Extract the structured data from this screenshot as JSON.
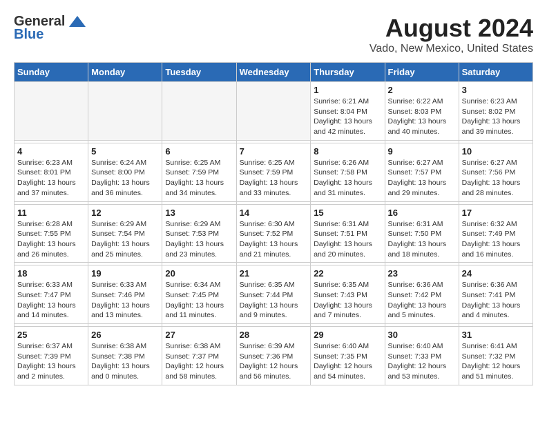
{
  "header": {
    "logo_general": "General",
    "logo_blue": "Blue",
    "month_year": "August 2024",
    "location": "Vado, New Mexico, United States"
  },
  "weekdays": [
    "Sunday",
    "Monday",
    "Tuesday",
    "Wednesday",
    "Thursday",
    "Friday",
    "Saturday"
  ],
  "weeks": [
    [
      {
        "day": "",
        "sunrise": "",
        "sunset": "",
        "daylight": ""
      },
      {
        "day": "",
        "sunrise": "",
        "sunset": "",
        "daylight": ""
      },
      {
        "day": "",
        "sunrise": "",
        "sunset": "",
        "daylight": ""
      },
      {
        "day": "",
        "sunrise": "",
        "sunset": "",
        "daylight": ""
      },
      {
        "day": "1",
        "sunrise": "Sunrise: 6:21 AM",
        "sunset": "Sunset: 8:04 PM",
        "daylight": "Daylight: 13 hours and 42 minutes."
      },
      {
        "day": "2",
        "sunrise": "Sunrise: 6:22 AM",
        "sunset": "Sunset: 8:03 PM",
        "daylight": "Daylight: 13 hours and 40 minutes."
      },
      {
        "day": "3",
        "sunrise": "Sunrise: 6:23 AM",
        "sunset": "Sunset: 8:02 PM",
        "daylight": "Daylight: 13 hours and 39 minutes."
      }
    ],
    [
      {
        "day": "4",
        "sunrise": "Sunrise: 6:23 AM",
        "sunset": "Sunset: 8:01 PM",
        "daylight": "Daylight: 13 hours and 37 minutes."
      },
      {
        "day": "5",
        "sunrise": "Sunrise: 6:24 AM",
        "sunset": "Sunset: 8:00 PM",
        "daylight": "Daylight: 13 hours and 36 minutes."
      },
      {
        "day": "6",
        "sunrise": "Sunrise: 6:25 AM",
        "sunset": "Sunset: 7:59 PM",
        "daylight": "Daylight: 13 hours and 34 minutes."
      },
      {
        "day": "7",
        "sunrise": "Sunrise: 6:25 AM",
        "sunset": "Sunset: 7:59 PM",
        "daylight": "Daylight: 13 hours and 33 minutes."
      },
      {
        "day": "8",
        "sunrise": "Sunrise: 6:26 AM",
        "sunset": "Sunset: 7:58 PM",
        "daylight": "Daylight: 13 hours and 31 minutes."
      },
      {
        "day": "9",
        "sunrise": "Sunrise: 6:27 AM",
        "sunset": "Sunset: 7:57 PM",
        "daylight": "Daylight: 13 hours and 29 minutes."
      },
      {
        "day": "10",
        "sunrise": "Sunrise: 6:27 AM",
        "sunset": "Sunset: 7:56 PM",
        "daylight": "Daylight: 13 hours and 28 minutes."
      }
    ],
    [
      {
        "day": "11",
        "sunrise": "Sunrise: 6:28 AM",
        "sunset": "Sunset: 7:55 PM",
        "daylight": "Daylight: 13 hours and 26 minutes."
      },
      {
        "day": "12",
        "sunrise": "Sunrise: 6:29 AM",
        "sunset": "Sunset: 7:54 PM",
        "daylight": "Daylight: 13 hours and 25 minutes."
      },
      {
        "day": "13",
        "sunrise": "Sunrise: 6:29 AM",
        "sunset": "Sunset: 7:53 PM",
        "daylight": "Daylight: 13 hours and 23 minutes."
      },
      {
        "day": "14",
        "sunrise": "Sunrise: 6:30 AM",
        "sunset": "Sunset: 7:52 PM",
        "daylight": "Daylight: 13 hours and 21 minutes."
      },
      {
        "day": "15",
        "sunrise": "Sunrise: 6:31 AM",
        "sunset": "Sunset: 7:51 PM",
        "daylight": "Daylight: 13 hours and 20 minutes."
      },
      {
        "day": "16",
        "sunrise": "Sunrise: 6:31 AM",
        "sunset": "Sunset: 7:50 PM",
        "daylight": "Daylight: 13 hours and 18 minutes."
      },
      {
        "day": "17",
        "sunrise": "Sunrise: 6:32 AM",
        "sunset": "Sunset: 7:49 PM",
        "daylight": "Daylight: 13 hours and 16 minutes."
      }
    ],
    [
      {
        "day": "18",
        "sunrise": "Sunrise: 6:33 AM",
        "sunset": "Sunset: 7:47 PM",
        "daylight": "Daylight: 13 hours and 14 minutes."
      },
      {
        "day": "19",
        "sunrise": "Sunrise: 6:33 AM",
        "sunset": "Sunset: 7:46 PM",
        "daylight": "Daylight: 13 hours and 13 minutes."
      },
      {
        "day": "20",
        "sunrise": "Sunrise: 6:34 AM",
        "sunset": "Sunset: 7:45 PM",
        "daylight": "Daylight: 13 hours and 11 minutes."
      },
      {
        "day": "21",
        "sunrise": "Sunrise: 6:35 AM",
        "sunset": "Sunset: 7:44 PM",
        "daylight": "Daylight: 13 hours and 9 minutes."
      },
      {
        "day": "22",
        "sunrise": "Sunrise: 6:35 AM",
        "sunset": "Sunset: 7:43 PM",
        "daylight": "Daylight: 13 hours and 7 minutes."
      },
      {
        "day": "23",
        "sunrise": "Sunrise: 6:36 AM",
        "sunset": "Sunset: 7:42 PM",
        "daylight": "Daylight: 13 hours and 5 minutes."
      },
      {
        "day": "24",
        "sunrise": "Sunrise: 6:36 AM",
        "sunset": "Sunset: 7:41 PM",
        "daylight": "Daylight: 13 hours and 4 minutes."
      }
    ],
    [
      {
        "day": "25",
        "sunrise": "Sunrise: 6:37 AM",
        "sunset": "Sunset: 7:39 PM",
        "daylight": "Daylight: 13 hours and 2 minutes."
      },
      {
        "day": "26",
        "sunrise": "Sunrise: 6:38 AM",
        "sunset": "Sunset: 7:38 PM",
        "daylight": "Daylight: 13 hours and 0 minutes."
      },
      {
        "day": "27",
        "sunrise": "Sunrise: 6:38 AM",
        "sunset": "Sunset: 7:37 PM",
        "daylight": "Daylight: 12 hours and 58 minutes."
      },
      {
        "day": "28",
        "sunrise": "Sunrise: 6:39 AM",
        "sunset": "Sunset: 7:36 PM",
        "daylight": "Daylight: 12 hours and 56 minutes."
      },
      {
        "day": "29",
        "sunrise": "Sunrise: 6:40 AM",
        "sunset": "Sunset: 7:35 PM",
        "daylight": "Daylight: 12 hours and 54 minutes."
      },
      {
        "day": "30",
        "sunrise": "Sunrise: 6:40 AM",
        "sunset": "Sunset: 7:33 PM",
        "daylight": "Daylight: 12 hours and 53 minutes."
      },
      {
        "day": "31",
        "sunrise": "Sunrise: 6:41 AM",
        "sunset": "Sunset: 7:32 PM",
        "daylight": "Daylight: 12 hours and 51 minutes."
      }
    ]
  ]
}
